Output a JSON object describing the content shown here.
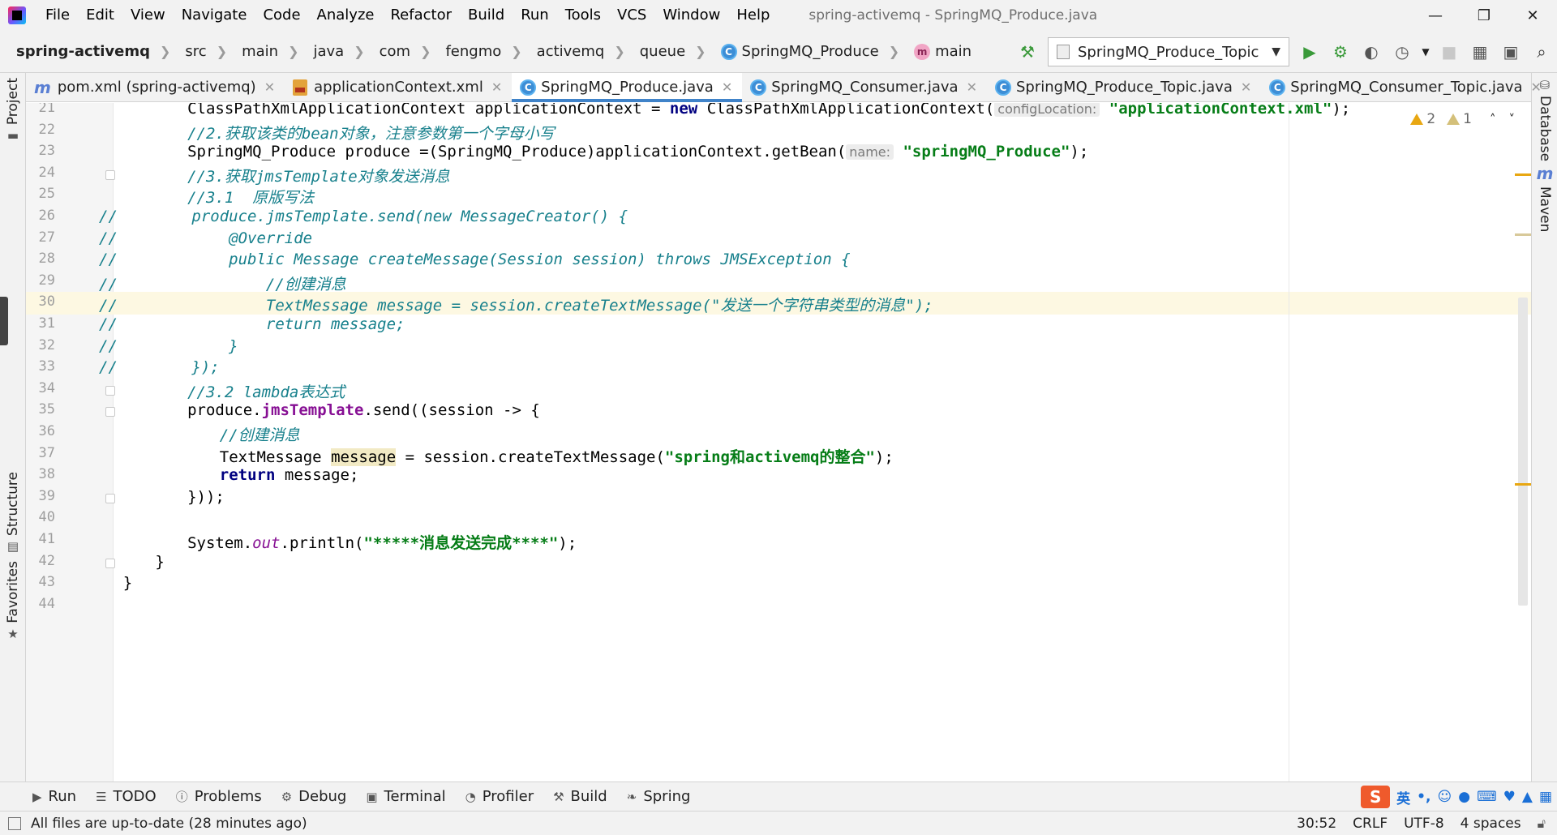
{
  "window": {
    "title": "spring-activemq - SpringMQ_Produce.java",
    "menu": [
      "File",
      "Edit",
      "View",
      "Navigate",
      "Code",
      "Analyze",
      "Refactor",
      "Build",
      "Run",
      "Tools",
      "VCS",
      "Window",
      "Help"
    ]
  },
  "breadcrumbs": [
    "spring-activemq",
    "src",
    "main",
    "java",
    "com",
    "fengmo",
    "activemq",
    "queue",
    "SpringMQ_Produce",
    "main"
  ],
  "toolbar": {
    "run_config": "SpringMQ_Produce_Topic",
    "icons": [
      "hammer-icon",
      "run-icon",
      "debug-icon",
      "coverage-icon",
      "profile-icon",
      "stop-icon",
      "project-structure-icon",
      "terminal-icon",
      "search-icon"
    ]
  },
  "tabs": [
    {
      "label": "pom.xml (spring-activemq)",
      "icon": "maven-icon",
      "active": false
    },
    {
      "label": "applicationContext.xml",
      "icon": "xml-icon",
      "active": false
    },
    {
      "label": "SpringMQ_Produce.java",
      "icon": "class-icon",
      "active": true
    },
    {
      "label": "SpringMQ_Consumer.java",
      "icon": "class-icon",
      "active": false
    },
    {
      "label": "SpringMQ_Produce_Topic.java",
      "icon": "class-icon",
      "active": false
    },
    {
      "label": "SpringMQ_Consumer_Topic.java",
      "icon": "class-icon",
      "active": false
    }
  ],
  "left_tools": [
    "Project",
    "Structure",
    "Favorites"
  ],
  "right_tools": [
    "Database",
    "Maven"
  ],
  "inspections": {
    "warnings": "2",
    "weak_warnings": "1"
  },
  "editor": {
    "first_line": 21,
    "caret_line": 30,
    "line_numbers": [
      "21",
      "22",
      "23",
      "24",
      "25",
      "26",
      "27",
      "28",
      "29",
      "30",
      "31",
      "32",
      "33",
      "34",
      "35",
      "36",
      "37",
      "38",
      "39",
      "40",
      "41",
      "42",
      "43",
      "44"
    ],
    "hints": {
      "config_location": "configLocation:",
      "name": "name:"
    },
    "code": {
      "l21_a": "ClassPathXmlApplicationContext applicationContext = ",
      "l21_kw": "new",
      "l21_b": " ClassPathXmlApplicationContext(",
      "l21_str": "\"applicationContext.xml\"",
      "l21_c": ");",
      "l22": "//2.获取该类的bean对象，注意参数第一个字母小写",
      "l23_a": "SpringMQ_Produce produce =(SpringMQ_Produce)applicationContext.getBean(",
      "l23_str": "\"springMQ_Produce\"",
      "l23_b": ");",
      "l24": "//3.获取jmsTemplate对象发送消息",
      "l25": "//3.1  原版写法",
      "l26": "//        produce.jmsTemplate.send(new MessageCreator() {",
      "l27": "//            @Override",
      "l28": "//            public Message createMessage(Session session) throws JMSException {",
      "l29": "//                //创建消息",
      "l30": "//                TextMessage message = session.createTextMessage(\"发送一个字符串类型的消息\");",
      "l31": "//                return message;",
      "l32": "//            }",
      "l33": "//        });",
      "l34": "//3.2 lambda表达式",
      "l35_a": "produce.",
      "l35_fld": "jmsTemplate",
      "l35_b": ".send((session -> {",
      "l36": "//创建消息",
      "l37_a": "TextMessage ",
      "l37_var": "message",
      "l37_b": " = session.createTextMessage(",
      "l37_str": "\"spring和activemq的整合\"",
      "l37_c": ");",
      "l38_kw": "return",
      "l38_b": " message;",
      "l39": "}));",
      "l41_a": "System.",
      "l41_static": "out",
      "l41_b": ".println(",
      "l41_str": "\"*****消息发送完成****\"",
      "l41_c": ");",
      "l42": "}",
      "l43": "}"
    }
  },
  "bottom_tools": [
    {
      "label": "Run",
      "icon": "run-icon"
    },
    {
      "label": "TODO",
      "icon": "list-icon"
    },
    {
      "label": "Problems",
      "icon": "problems-icon"
    },
    {
      "label": "Debug",
      "icon": "bug-icon"
    },
    {
      "label": "Terminal",
      "icon": "terminal-icon"
    },
    {
      "label": "Profiler",
      "icon": "profiler-icon"
    },
    {
      "label": "Build",
      "icon": "hammer-icon"
    },
    {
      "label": "Spring",
      "icon": "leaf-icon"
    }
  ],
  "ime": {
    "logo": "S",
    "lang": "英"
  },
  "status": {
    "message": "All files are up-to-date (28 minutes ago)",
    "position": "30:52",
    "line_sep": "CRLF",
    "encoding": "UTF-8",
    "indent": "4 spaces"
  },
  "colors": {
    "accent": "#4083c9",
    "comment": "#17808c",
    "keyword": "#000080",
    "string": "#067d17",
    "field": "#871094",
    "caret_line": "#fdf8e2"
  }
}
